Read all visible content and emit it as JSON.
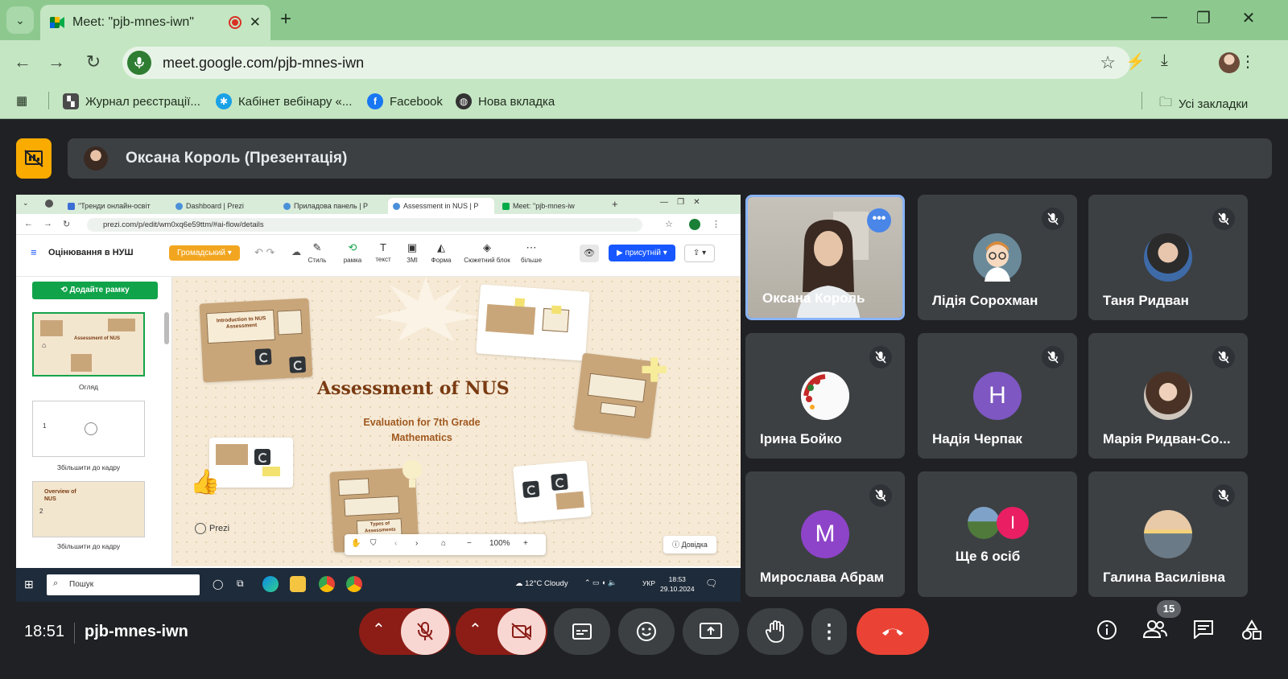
{
  "browser": {
    "tab_title": "Meet: \"pjb-mnes-iwn\"",
    "url": "meet.google.com/pjb-mnes-iwn",
    "bookmarks": [
      {
        "label": "Журнал реєстрації...",
        "icon": "grid-logo-icon"
      },
      {
        "label": "Кабінет вебінару «...",
        "icon": "snowflake-icon"
      },
      {
        "label": "Facebook",
        "icon": "facebook-icon"
      },
      {
        "label": "Нова вкладка",
        "icon": "globe-icon"
      }
    ],
    "all_bookmarks": "Усі закладки"
  },
  "meet": {
    "presenter_label": "Оксана Король (Презентація)",
    "time": "18:51",
    "meeting_code": "pjb-mnes-iwn",
    "people_count": "15",
    "accent": "#8ab4f8",
    "end_call_color": "#ea4335"
  },
  "shared_screen": {
    "tabs": [
      "\"Тренди онлайн-освіт",
      "Dashboard | Prezi",
      "Приладова панель | P",
      "Assessment in NUS | P",
      "Meet: \"pjb-mnes-iw"
    ],
    "url": "prezi.com/p/edit/wm0xq6e59ttm/#ai-flow/details",
    "prezi": {
      "doc_title": "Оцінювання в НУШ",
      "theme": "Громадський",
      "tools": [
        "Стиль",
        "рамка",
        "текст",
        "ЗМІ",
        "Форма",
        "Сюжетний блок",
        "більше"
      ],
      "present_btn": "присутній",
      "add_frame": "Додайте рамку",
      "thumbs": [
        {
          "label": "Огляд",
          "title": "Assessment of NUS"
        },
        {
          "label": "Збільшити до кадру",
          "num": "1"
        },
        {
          "label": "Збільшити до кадру",
          "num": "2",
          "title": "Overview of NUS"
        }
      ],
      "canvas_title": "Assessment of NUS",
      "canvas_subtitle": "Evaluation for 7th Grade Mathematics",
      "card_intro": "Introduction to NUS Assessment",
      "card_types": "Types of Assessments",
      "zoom": "100%",
      "help": "Довідка",
      "logo": "Prezi"
    },
    "taskbar": {
      "search": "Пошук",
      "weather": "12°C Cloudy",
      "lang": "УКР",
      "time": "18:53",
      "date": "29.10.2024"
    }
  },
  "participants": [
    {
      "name": "Оксана Король",
      "type": "video",
      "muted": false
    },
    {
      "name": "Лідія Сорохман",
      "type": "cartoon",
      "muted": true
    },
    {
      "name": "Таня Ридван",
      "type": "photo",
      "muted": true
    },
    {
      "name": "Ірина Бойко",
      "type": "ornament",
      "muted": true
    },
    {
      "name": "Надія Черпак",
      "type": "letter",
      "letter": "Н",
      "color": "#7e57c2",
      "muted": true
    },
    {
      "name": "Марія Ридван-Со...",
      "type": "photo",
      "muted": true
    },
    {
      "name": "Мирослава Абрам",
      "type": "letter",
      "letter": "М",
      "color": "#8e44c9",
      "muted": true
    },
    {
      "name": "Ще 6 осіб",
      "type": "others",
      "letter": "І",
      "muted": false
    },
    {
      "name": "Галина Василівна",
      "type": "photo",
      "muted": true
    }
  ]
}
